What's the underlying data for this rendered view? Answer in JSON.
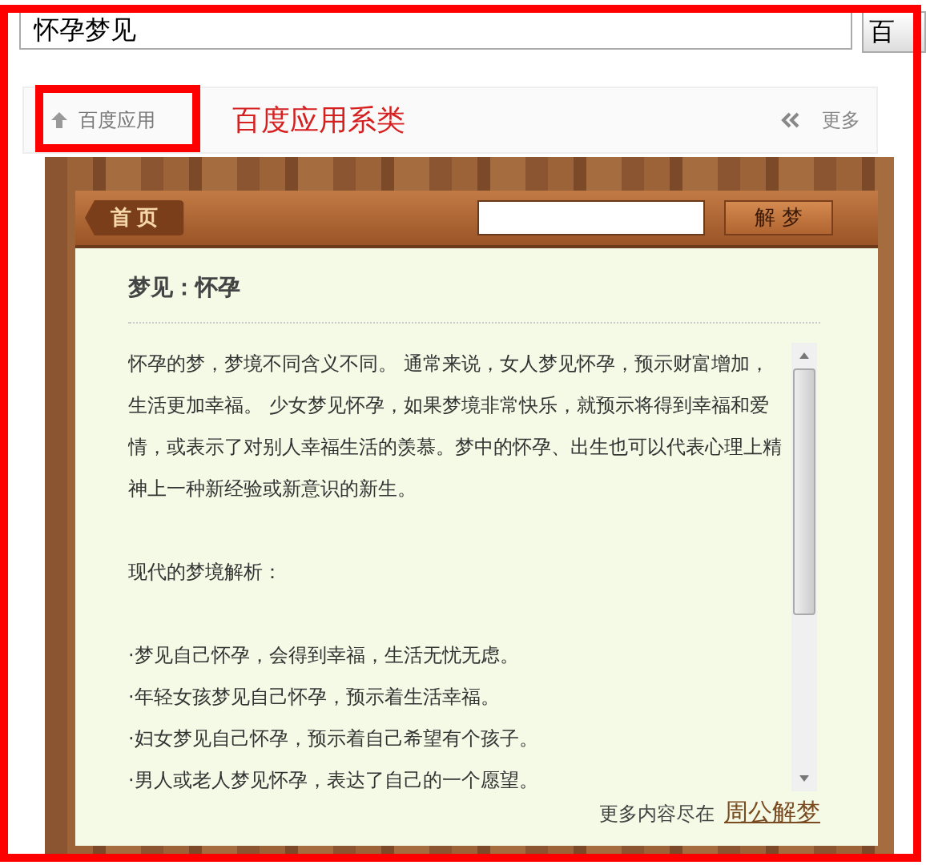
{
  "search": {
    "value": "怀孕梦见",
    "button": "百"
  },
  "header": {
    "crumb": "百度应用",
    "title": "百度应用系类",
    "more": "更多"
  },
  "app": {
    "home_tab": "首 页",
    "search_button": "解 梦",
    "heading": "梦见：怀孕",
    "paragraphs": [
      {
        "kind": "text",
        "text": "怀孕的梦，梦境不同含义不同。 通常来说，女人梦见怀孕，预示财富增加，生活更加幸福。 少女梦见怀孕，如果梦境非常快乐，就预示将得到幸福和爱情，或表示了对别人幸福生活的羡慕。梦中的怀孕、出生也可以代表心理上精神上一种新经验或新意识的新生。"
      },
      {
        "kind": "text",
        "text": "现代的梦境解析："
      },
      {
        "kind": "bullet",
        "text": "·梦见自己怀孕，会得到幸福，生活无忧无虑。"
      },
      {
        "kind": "bullet",
        "text": "·年轻女孩梦见自己怀孕，预示着生活幸福。"
      },
      {
        "kind": "bullet",
        "text": "·妇女梦见自己怀孕，预示着自己希望有个孩子。"
      },
      {
        "kind": "bullet",
        "text": "·男人或老人梦见怀孕，表达了自己的一个愿望。"
      }
    ],
    "footer_text": "更多内容尽在",
    "footer_link": "周公解梦"
  }
}
